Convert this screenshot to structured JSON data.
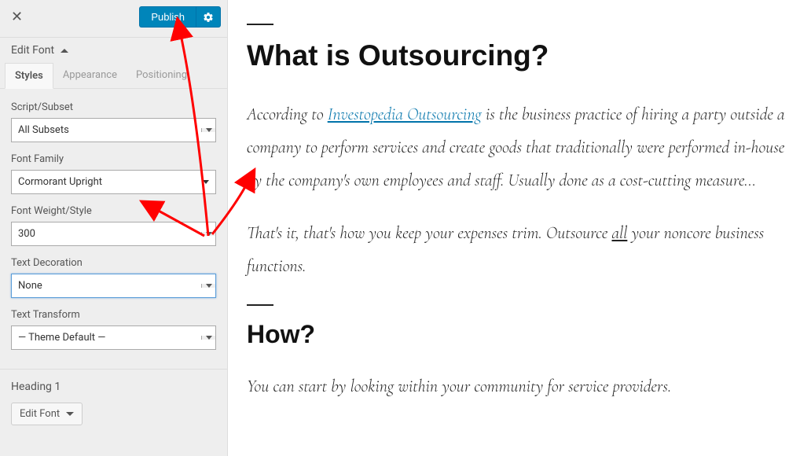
{
  "topbar": {
    "publish_label": "Publish"
  },
  "editFont": {
    "title": "Edit Font"
  },
  "tabs": {
    "styles": "Styles",
    "appearance": "Appearance",
    "positioning": "Positioning"
  },
  "labels": {
    "script_subset": "Script/Subset",
    "font_family": "Font Family",
    "font_weight": "Font Weight/Style",
    "text_decoration": "Text Decoration",
    "text_transform": "Text Transform",
    "heading1": "Heading 1",
    "edit_font_btn": "Edit Font"
  },
  "values": {
    "script_subset": "All Subsets",
    "font_family": "Cormorant Upright",
    "font_weight": "300",
    "text_decoration": "None",
    "text_transform": "— Theme Default —"
  },
  "content": {
    "heading1": "What is Outsourcing?",
    "para1_prefix": "According to ",
    "para1_link": "Investopedia Outsourcing",
    "para1_rest": " is the business practice of hiring a party outside a company to perform services and create goods that traditionally were performed in-house by the company's own employees and staff. Usually done as a cost-cutting measure…",
    "para2_prefix": "That's it, that's how you keep your expenses trim. Outsource ",
    "para2_underline": "all",
    "para2_rest": " your noncore business functions.",
    "heading2": "How?",
    "para3": "You can start by looking within your community for service providers."
  }
}
